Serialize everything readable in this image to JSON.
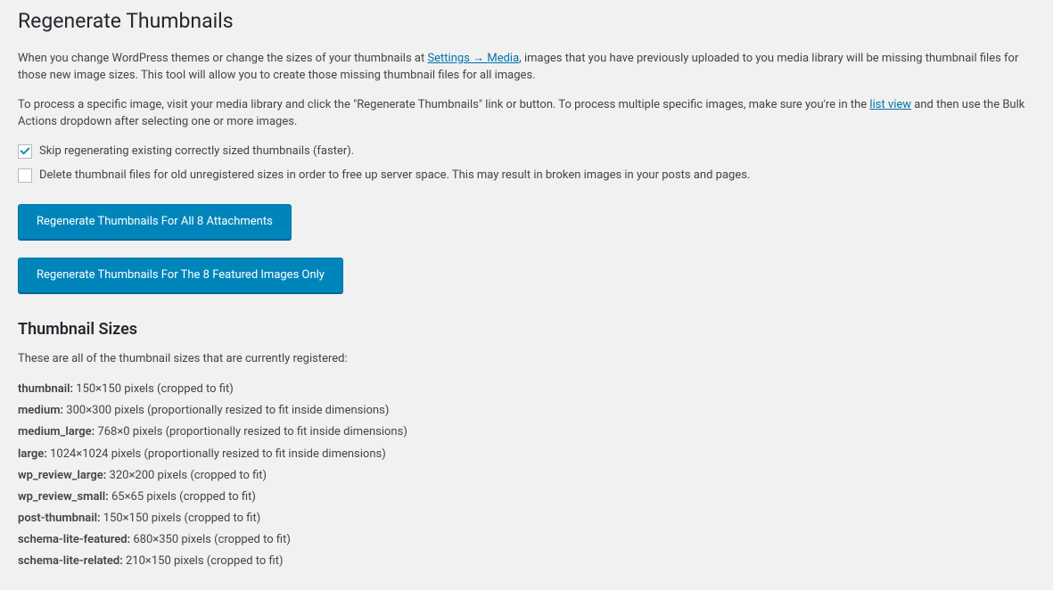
{
  "page_title": "Regenerate Thumbnails",
  "intro": {
    "p1_a": "When you change WordPress themes or change the sizes of your thumbnails at ",
    "p1_link": "Settings → Media",
    "p1_b": ", images that you have previously uploaded to you media library will be missing thumbnail files for those new image sizes. This tool will allow you to create those missing thumbnail files for all images.",
    "p2_a": "To process a specific image, visit your media library and click the \"Regenerate Thumbnails\" link or button. To process multiple specific images, make sure you're in the ",
    "p2_link": "list view",
    "p2_b": " and then use the Bulk Actions dropdown after selecting one or more images."
  },
  "checkboxes": {
    "skip_existing": {
      "label": "Skip regenerating existing correctly sized thumbnails (faster).",
      "checked": true
    },
    "delete_old": {
      "label": "Delete thumbnail files for old unregistered sizes in order to free up server space. This may result in broken images in your posts and pages.",
      "checked": false
    }
  },
  "buttons": {
    "regen_all": "Regenerate Thumbnails For All 8 Attachments",
    "regen_featured": "Regenerate Thumbnails For The 8 Featured Images Only"
  },
  "sizes_heading": "Thumbnail Sizes",
  "sizes_intro": "These are all of the thumbnail sizes that are currently registered:",
  "sizes": [
    {
      "name": "thumbnail:",
      "desc": " 150×150 pixels (cropped to fit)"
    },
    {
      "name": "medium:",
      "desc": " 300×300 pixels (proportionally resized to fit inside dimensions)"
    },
    {
      "name": "medium_large:",
      "desc": " 768×0 pixels (proportionally resized to fit inside dimensions)"
    },
    {
      "name": "large:",
      "desc": " 1024×1024 pixels (proportionally resized to fit inside dimensions)"
    },
    {
      "name": "wp_review_large:",
      "desc": " 320×200 pixels (cropped to fit)"
    },
    {
      "name": "wp_review_small:",
      "desc": " 65×65 pixels (cropped to fit)"
    },
    {
      "name": "post-thumbnail:",
      "desc": " 150×150 pixels (cropped to fit)"
    },
    {
      "name": "schema-lite-featured:",
      "desc": " 680×350 pixels (cropped to fit)"
    },
    {
      "name": "schema-lite-related:",
      "desc": " 210×150 pixels (cropped to fit)"
    }
  ]
}
